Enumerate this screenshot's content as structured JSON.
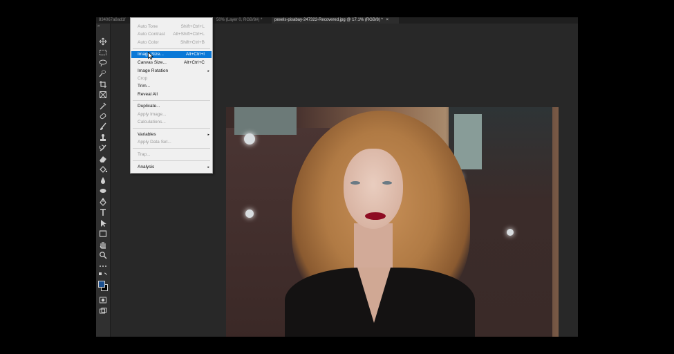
{
  "tabs": [
    {
      "label": "834067a8ad1f",
      "active": false
    },
    {
      "label": "50% (Layer 0, RGB/8#) *",
      "active": false
    },
    {
      "label": "pexels-pixabay-247322-Recovered.jpg @ 17.1% (RGB/8) *",
      "active": true
    }
  ],
  "tab_close": "×",
  "toolbar": {
    "collapse": "»",
    "tools": [
      "move-icon",
      "marquee-icon",
      "lasso-icon",
      "quick-select-icon",
      "crop-icon",
      "frame-icon",
      "eyedropper-icon",
      "healing-brush-icon",
      "brush-icon",
      "clone-stamp-icon",
      "history-brush-icon",
      "eraser-icon",
      "paint-bucket-icon",
      "blur-icon",
      "dodge-icon",
      "pen-icon",
      "type-icon",
      "path-select-icon",
      "rectangle-icon",
      "hand-icon",
      "zoom-icon",
      "more-tools-icon"
    ],
    "foreground_color": "#1b4f8f",
    "background_color": "#000000"
  },
  "menu": {
    "items": [
      {
        "label": "Auto Tone",
        "shortcut": "Shift+Ctrl+L",
        "disabled": true
      },
      {
        "label": "Auto Contrast",
        "shortcut": "Alt+Shift+Ctrl+L",
        "disabled": true
      },
      {
        "label": "Auto Color",
        "shortcut": "Shift+Ctrl+B",
        "disabled": true
      },
      {
        "label": "Image Size...",
        "shortcut": "Alt+Ctrl+I",
        "selected": true
      },
      {
        "label": "Canvas Size...",
        "shortcut": "Alt+Ctrl+C"
      },
      {
        "label": "Image Rotation",
        "submenu": true
      },
      {
        "label": "Crop",
        "disabled": true
      },
      {
        "label": "Trim..."
      },
      {
        "label": "Reveal All"
      },
      {
        "label": "Duplicate..."
      },
      {
        "label": "Apply Image...",
        "disabled": true
      },
      {
        "label": "Calculations...",
        "disabled": true
      },
      {
        "label": "Variables",
        "submenu": true
      },
      {
        "label": "Apply Data Set...",
        "disabled": true
      },
      {
        "label": "Trap...",
        "disabled": true
      },
      {
        "label": "Analysis",
        "submenu": true
      }
    ],
    "submenu_arrow": "▸",
    "highlight_color": "#0a78d7"
  }
}
